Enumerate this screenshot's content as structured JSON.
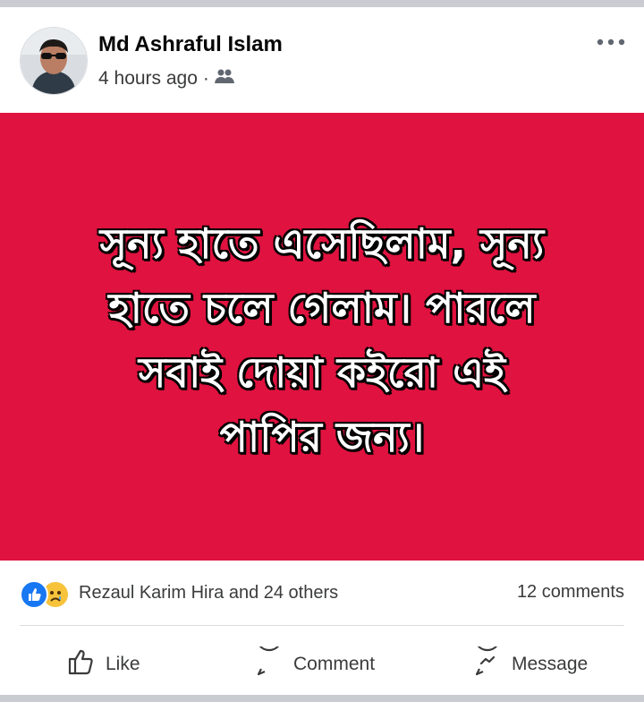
{
  "post": {
    "author": "Md Ashraful Islam",
    "time": "4 hours ago",
    "separator": "·",
    "audience_icon": "friends-icon",
    "text_lines": [
      "সূন্য হাতে এসেছিলাম, সূন্য",
      "হাতে চলে গেলাম। পারলে",
      "সবাই দোয়া কইরো এই",
      "পাপির জন্য।"
    ],
    "background_color": "#e0123f"
  },
  "reactions": {
    "icons": [
      "like-reaction-icon",
      "sad-reaction-icon"
    ],
    "summary": "Rezaul Karim Hira and 24 others",
    "comments": "12 comments"
  },
  "actions": {
    "like": "Like",
    "comment": "Comment",
    "message": "Message"
  },
  "colors": {
    "accent": "#1877f2",
    "text_secondary": "#3a3b3c"
  }
}
